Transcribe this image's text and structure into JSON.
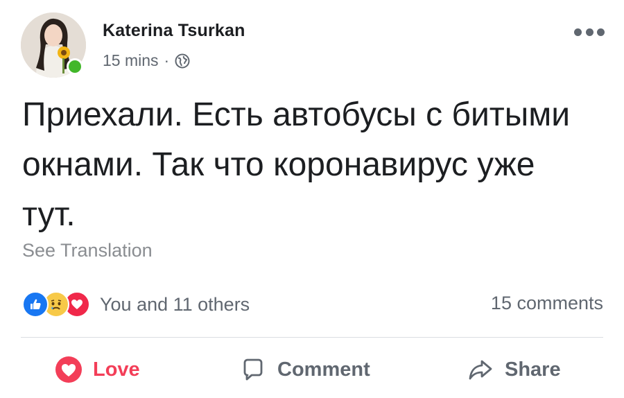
{
  "post": {
    "author": "Katerina Tsurkan",
    "timestamp": "15 mins",
    "separator": "·",
    "privacy_icon": "globe-icon",
    "text": "Приехали. Есть автобусы с битыми окнами. Так что коронавирус уже тут.",
    "see_translation": "See Translation",
    "reactions": {
      "icons": [
        "like-icon",
        "sad-icon",
        "love-icon"
      ],
      "summary": "You and 11 others",
      "comments": "15 comments"
    },
    "actions": {
      "love": "Love",
      "comment": "Comment",
      "share": "Share"
    }
  },
  "colors": {
    "like": "#1877f2",
    "love": "#f33e58",
    "online": "#42b72a",
    "secondary_text": "#606770"
  }
}
